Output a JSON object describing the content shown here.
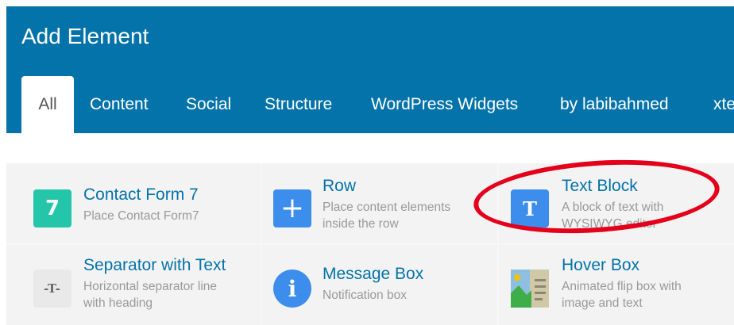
{
  "dialog": {
    "title": "Add Element"
  },
  "tabs": [
    {
      "label": "All",
      "active": true
    },
    {
      "label": "Content",
      "active": false
    },
    {
      "label": "Social",
      "active": false
    },
    {
      "label": "Structure",
      "active": false
    },
    {
      "label": "WordPress Widgets",
      "active": false
    },
    {
      "label": "by labibahmed",
      "active": false
    },
    {
      "label": "xte",
      "active": false
    }
  ],
  "elements": [
    {
      "name": "Contact Form 7",
      "description": "Place Contact Form7",
      "icon": "contact-form-7-icon",
      "icon_glyph": "7",
      "icon_color": "#24c5a8"
    },
    {
      "name": "Row",
      "description": "Place content elements\ninside the row",
      "icon": "plus-icon",
      "icon_glyph": "+",
      "icon_color": "#3d8ded"
    },
    {
      "name": "Text Block",
      "description": "A block of text with\nWYSIWYG editor",
      "icon": "text-block-icon",
      "icon_glyph": "T",
      "icon_color": "#3d8ded"
    },
    {
      "name": "Separator with Text",
      "description": "Horizontal separator line\nwith heading",
      "icon": "separator-text-icon",
      "icon_glyph": "-T-",
      "icon_color": "#e9e9e9"
    },
    {
      "name": "Message Box",
      "description": "Notification box",
      "icon": "info-icon",
      "icon_glyph": "i",
      "icon_color": "#3d8ded"
    },
    {
      "name": "Hover Box",
      "description": "Animated flip box with\nimage and text",
      "icon": "hover-box-icon",
      "icon_glyph": "",
      "icon_color": "#cfc9a7"
    }
  ],
  "annotation": {
    "color": "#e4001b"
  }
}
